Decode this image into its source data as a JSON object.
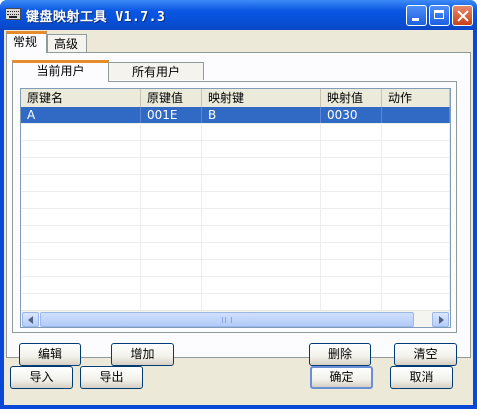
{
  "window": {
    "title": "键盘映射工具 V1.7.3"
  },
  "tabs": [
    {
      "label": "常规"
    },
    {
      "label": "高级"
    }
  ],
  "user_tabs": [
    {
      "label": "当前用户"
    },
    {
      "label": "所有用户"
    }
  ],
  "table": {
    "columns": [
      "原键名",
      "原键值",
      "映射键",
      "映射值",
      "动作"
    ],
    "rows": [
      [
        "A",
        "001E",
        "B",
        "0030",
        ""
      ]
    ],
    "selected_row": 0
  },
  "panel_buttons": {
    "edit": "编辑",
    "add": "增加",
    "delete": "删除",
    "clear": "清空"
  },
  "dialog_buttons": {
    "import": "导入",
    "export": "导出",
    "ok": "确定",
    "cancel": "取消"
  },
  "colors": {
    "selection": "#316ac5",
    "titlebar": "#0a4fd8",
    "active_tab_accent": "#e68b2c"
  },
  "icons": {
    "app": "keyboard-icon",
    "minimize": "minimize-icon",
    "maximize": "maximize-icon",
    "close": "close-icon"
  }
}
